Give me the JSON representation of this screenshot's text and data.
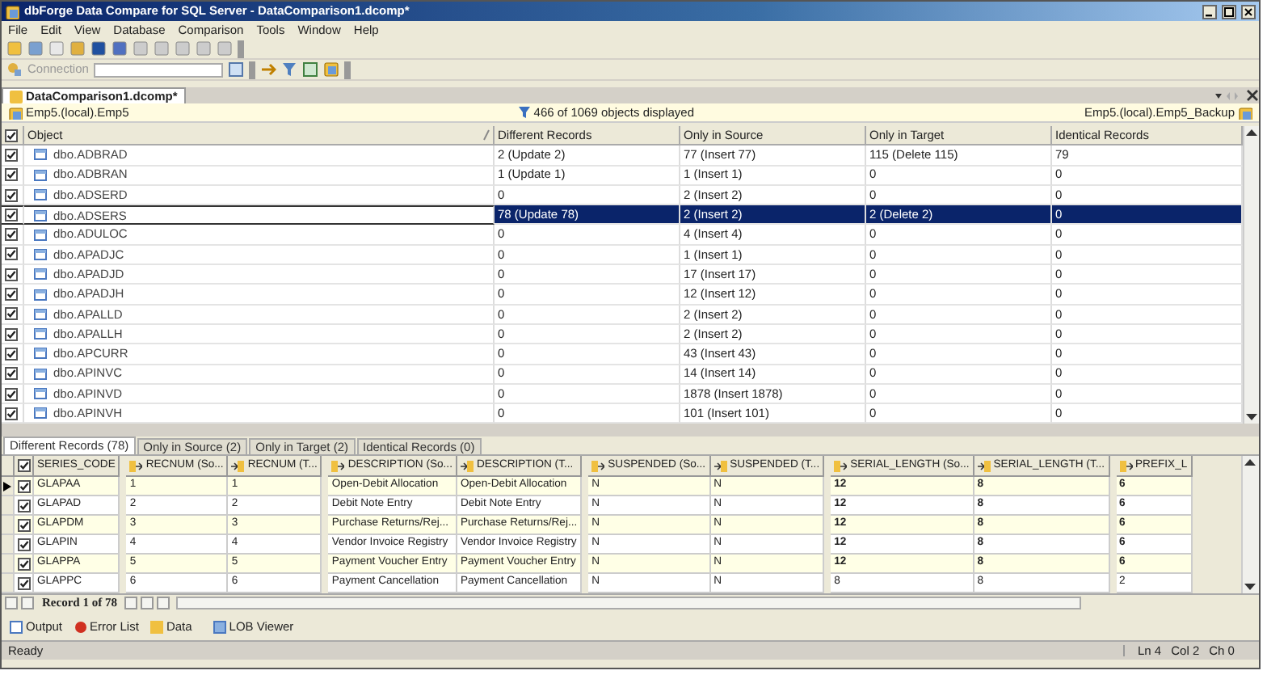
{
  "window": {
    "title": "dbForge Data Compare for SQL Server - DataComparison1.dcomp*"
  },
  "menu": [
    "File",
    "Edit",
    "View",
    "Database",
    "Comparison",
    "Tools",
    "Window",
    "Help"
  ],
  "toolbar": {
    "connection_label": "Connection"
  },
  "document_tab": {
    "label": "DataComparison1.dcomp*"
  },
  "info_bar": {
    "source": "Emp5.(local).Emp5",
    "filter_status": "466 of 1069 objects displayed",
    "target": "Emp5.(local).Emp5_Backup"
  },
  "objects_grid": {
    "all_checked": true,
    "columns": [
      "Object",
      "Different Records",
      "Only in Source",
      "Only in Target",
      "Identical Records"
    ],
    "rows": [
      {
        "checked": true,
        "selected": false,
        "cells": [
          "dbo.ADBRAD",
          "2 (Update 2)",
          "77 (Insert 77)",
          "115 (Delete 115)",
          "79"
        ]
      },
      {
        "checked": true,
        "selected": false,
        "cells": [
          "dbo.ADBRAN",
          "1 (Update 1)",
          "1 (Insert 1)",
          "0",
          "0"
        ]
      },
      {
        "checked": true,
        "selected": false,
        "cells": [
          "dbo.ADSERD",
          "0",
          "2 (Insert 2)",
          "0",
          "0"
        ]
      },
      {
        "checked": true,
        "selected": true,
        "cells": [
          "dbo.ADSERS",
          "78 (Update 78)",
          "2 (Insert 2)",
          "2 (Delete 2)",
          "0"
        ]
      },
      {
        "checked": true,
        "selected": false,
        "cells": [
          "dbo.ADULOC",
          "0",
          "4 (Insert 4)",
          "0",
          "0"
        ]
      },
      {
        "checked": true,
        "selected": false,
        "cells": [
          "dbo.APADJC",
          "0",
          "1 (Insert 1)",
          "0",
          "0"
        ]
      },
      {
        "checked": true,
        "selected": false,
        "cells": [
          "dbo.APADJD",
          "0",
          "17 (Insert 17)",
          "0",
          "0"
        ]
      },
      {
        "checked": true,
        "selected": false,
        "cells": [
          "dbo.APADJH",
          "0",
          "12 (Insert 12)",
          "0",
          "0"
        ]
      },
      {
        "checked": true,
        "selected": false,
        "cells": [
          "dbo.APALLD",
          "0",
          "2 (Insert 2)",
          "0",
          "0"
        ]
      },
      {
        "checked": true,
        "selected": false,
        "cells": [
          "dbo.APALLH",
          "0",
          "2 (Insert 2)",
          "0",
          "0"
        ]
      },
      {
        "checked": true,
        "selected": false,
        "cells": [
          "dbo.APCURR",
          "0",
          "43 (Insert 43)",
          "0",
          "0"
        ]
      },
      {
        "checked": true,
        "selected": false,
        "cells": [
          "dbo.APINVC",
          "0",
          "14 (Insert 14)",
          "0",
          "0"
        ]
      },
      {
        "checked": true,
        "selected": false,
        "cells": [
          "dbo.APINVD",
          "0",
          "1878 (Insert 1878)",
          "0",
          "0"
        ]
      },
      {
        "checked": true,
        "selected": false,
        "cells": [
          "dbo.APINVH",
          "0",
          "101 (Insert 101)",
          "0",
          "0"
        ]
      }
    ]
  },
  "records_tabs": [
    {
      "label": "Different Records (78)",
      "selected": true
    },
    {
      "label": "Only in Source (2)",
      "selected": false
    },
    {
      "label": "Only in Target (2)",
      "selected": false
    },
    {
      "label": "Identical Records (0)",
      "selected": false
    }
  ],
  "records_grid": {
    "all_checked": true,
    "columns": [
      {
        "label": "SERIES_CODE",
        "kind": "key",
        "emphasis": false
      },
      {
        "label": "RECNUM (So...",
        "kind": "source",
        "emphasis": false
      },
      {
        "label": "RECNUM (T...",
        "kind": "target",
        "emphasis": false
      },
      {
        "label": "DESCRIPTION (So...",
        "kind": "source",
        "emphasis": false
      },
      {
        "label": "DESCRIPTION (T...",
        "kind": "target",
        "emphasis": false
      },
      {
        "label": "SUSPENDED (So...",
        "kind": "source",
        "emphasis": false
      },
      {
        "label": "SUSPENDED (T...",
        "kind": "target",
        "emphasis": false
      },
      {
        "label": "SERIAL_LENGTH (So...",
        "kind": "source",
        "emphasis": true
      },
      {
        "label": "SERIAL_LENGTH (T...",
        "kind": "target",
        "emphasis": true
      },
      {
        "label": "PREFIX_L",
        "kind": "source",
        "emphasis": true
      }
    ],
    "rows": [
      {
        "current": true,
        "checked": true,
        "differs": true,
        "cells": [
          "GLAPAA",
          "1",
          "1",
          "Open-Debit Allocation",
          "Open-Debit Allocation",
          "N",
          "N",
          "12",
          "8",
          "6"
        ]
      },
      {
        "current": false,
        "checked": true,
        "differs": true,
        "cells": [
          "GLAPAD",
          "2",
          "2",
          "Debit Note Entry",
          "Debit Note Entry",
          "N",
          "N",
          "12",
          "8",
          "6"
        ]
      },
      {
        "current": false,
        "checked": true,
        "differs": true,
        "cells": [
          "GLAPDM",
          "3",
          "3",
          "Purchase Returns/Rej...",
          "Purchase Returns/Rej...",
          "N",
          "N",
          "12",
          "8",
          "6"
        ]
      },
      {
        "current": false,
        "checked": true,
        "differs": true,
        "cells": [
          "GLAPIN",
          "4",
          "4",
          "Vendor Invoice Registry",
          "Vendor Invoice Registry",
          "N",
          "N",
          "12",
          "8",
          "6"
        ]
      },
      {
        "current": false,
        "checked": true,
        "differs": true,
        "cells": [
          "GLAPPA",
          "5",
          "5",
          "Payment Voucher Entry",
          "Payment Voucher Entry",
          "N",
          "N",
          "12",
          "8",
          "6"
        ]
      },
      {
        "current": false,
        "checked": true,
        "differs": false,
        "cells": [
          "GLAPPC",
          "6",
          "6",
          "Payment Cancellation",
          "Payment Cancellation",
          "N",
          "N",
          "8",
          "8",
          "2"
        ]
      }
    ]
  },
  "navigator": {
    "text": "Record 1 of 78"
  },
  "tool_tabs": [
    {
      "label": "Output",
      "selected": false
    },
    {
      "label": "Error List",
      "selected": false
    },
    {
      "label": "Data",
      "selected": false
    },
    {
      "label": "LOB Viewer",
      "selected": false
    }
  ],
  "status_bar": {
    "text": "Ready",
    "line": "Ln 4",
    "column": "Col 2",
    "char": "Ch 0"
  }
}
